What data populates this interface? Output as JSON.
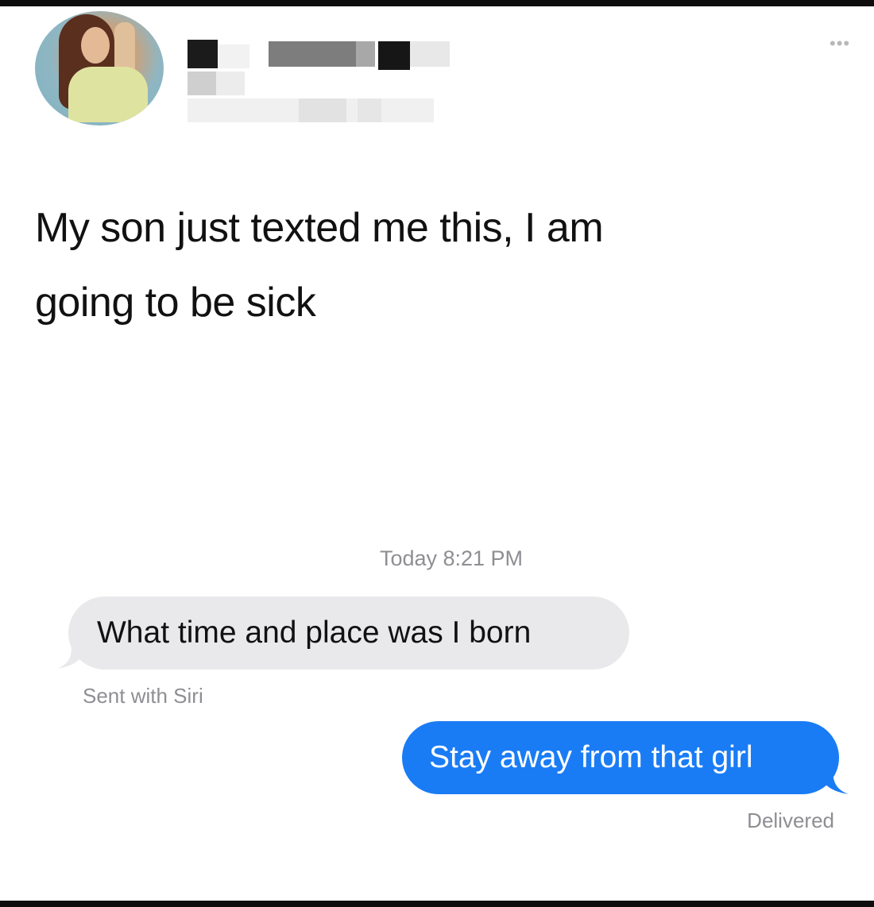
{
  "post": {
    "text_line1": "My son just texted me this, I am",
    "text_line2": "going to be sick",
    "more_icon": "ellipsis-icon"
  },
  "conversation": {
    "timestamp": "Today 8:21 PM",
    "incoming_message": "What time and place was I born",
    "incoming_note": "Sent with Siri",
    "outgoing_message": "Stay away from that girl",
    "outgoing_status": "Delivered"
  },
  "colors": {
    "outgoing_bubble": "#1a7cf5",
    "incoming_bubble": "#e9e9eb",
    "meta_text": "#8e8e93"
  }
}
